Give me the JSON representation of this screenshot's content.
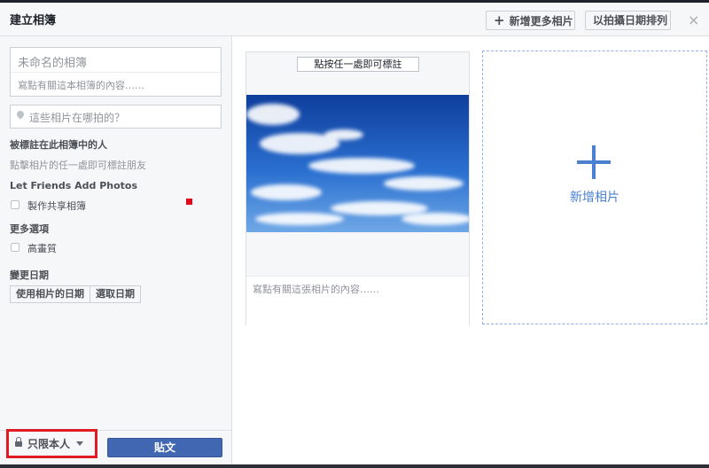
{
  "dialog": {
    "title": "建立相簿",
    "add_more_label": "新增更多相片",
    "sort_label": "以拍攝日期排列",
    "close_glyph": "×"
  },
  "sidebar": {
    "album_name_placeholder": "未命名的相簿",
    "album_desc_placeholder": "寫點有關這本相簿的內容……",
    "location_placeholder": "這些相片在哪拍的？",
    "tagged_heading": "被標註在此相簿中的人",
    "tagged_hint": "點擊相片的任一處即可標註朋友",
    "friends_heading": "Let Friends Add Photos",
    "shared_album_label": "製作共享相簿",
    "more_options_heading": "更多選項",
    "hq_label": "高畫質",
    "change_date_heading": "變更日期",
    "use_photo_date_label": "使用相片的日期",
    "pick_date_label": "選取日期"
  },
  "footer": {
    "privacy_label": "只限本人",
    "post_label": "貼文"
  },
  "photo": {
    "tag_hint": "點按任一處即可標註",
    "caption_placeholder": "寫點有關這張相片的內容……"
  },
  "add_photo": {
    "label": "新增相片"
  },
  "colors": {
    "accent": "#4267b2",
    "add_blue": "#4a7fd1",
    "highlight_red": "#e01b24"
  }
}
